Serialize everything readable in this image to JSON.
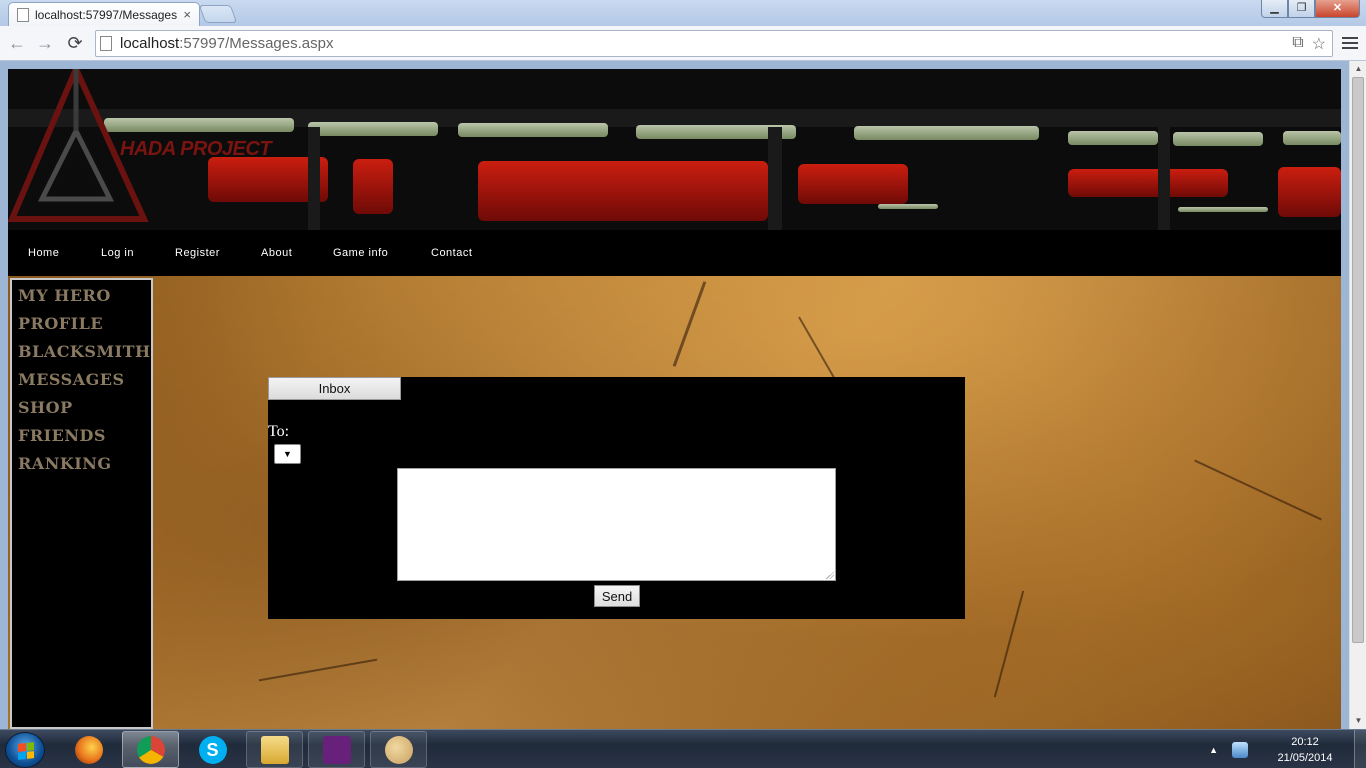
{
  "browser": {
    "tab_title": "localhost:57997/Messages",
    "tab_close": "×",
    "url_host": "localhost",
    "url_rest": ":57997/Messages.aspx",
    "back_icon": "←",
    "forward_icon": "→",
    "reload_icon": "⟳",
    "minimize": "▁",
    "maximize": "❐",
    "close": "✕",
    "star_icon": "☆",
    "translate_icon": "⧉"
  },
  "site": {
    "logo_text": "HADA PROJECT",
    "nav": [
      "Home",
      "Log in",
      "Register",
      "About",
      "Game info",
      "Contact"
    ],
    "sidebar": [
      "MY HERO",
      "PROFILE",
      "BLACKSMITH",
      "MESSAGES",
      "SHOP",
      "FRIENDS",
      "RANKING"
    ]
  },
  "messages": {
    "inbox_label": "Inbox",
    "to_label": "To:",
    "select_arrow": "▼",
    "message_value": "",
    "send_label": "Send"
  },
  "scrollbar": {
    "up": "▲",
    "down": "▼"
  },
  "taskbar": {
    "tray_arrow": "▲",
    "time": "20:12",
    "date": "21/05/2014",
    "colors": {
      "firefox": "#e8741c",
      "chrome": "#2e9e4a",
      "skype": "#00aff0",
      "explorer": "#e9c45a",
      "visual_studio": "#68217a",
      "paint": "#c8a060"
    }
  }
}
